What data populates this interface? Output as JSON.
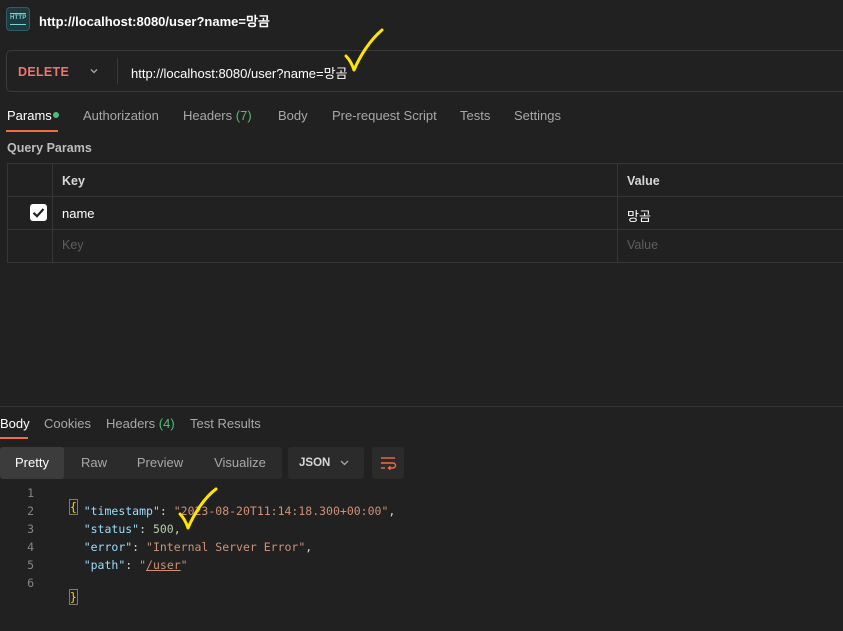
{
  "window": {
    "title": "http://localhost:8080/user?name=망곰",
    "icon": "http-file-icon"
  },
  "request": {
    "method": "DELETE",
    "url": "http://localhost:8080/user?name=망곰",
    "tabs": [
      {
        "label": "Params",
        "active": true,
        "dot": true
      },
      {
        "label": "Authorization"
      },
      {
        "label": "Headers",
        "badge": "(7)"
      },
      {
        "label": "Body"
      },
      {
        "label": "Pre-request Script"
      },
      {
        "label": "Tests"
      },
      {
        "label": "Settings"
      }
    ],
    "query_params": {
      "title": "Query Params",
      "headers": {
        "key": "Key",
        "value": "Value"
      },
      "rows": [
        {
          "checked": true,
          "key": "name",
          "value": "망곰"
        }
      ],
      "placeholder": {
        "key": "Key",
        "value": "Value"
      }
    }
  },
  "response": {
    "tabs": [
      {
        "label": "Body",
        "active": true
      },
      {
        "label": "Cookies"
      },
      {
        "label": "Headers",
        "badge": "(4)"
      },
      {
        "label": "Test Results"
      }
    ],
    "views": [
      "Pretty",
      "Raw",
      "Preview",
      "Visualize"
    ],
    "active_view": "Pretty",
    "format": "JSON",
    "code": {
      "line_numbers": [
        "1",
        "2",
        "3",
        "4",
        "5",
        "6"
      ],
      "open": "{",
      "close": "}",
      "timestamp_key": "\"timestamp\"",
      "timestamp_val": "\"2023-08-20T11:14:18.300+00:00\"",
      "status_key": "\"status\"",
      "status_val": "500",
      "error_key": "\"error\"",
      "error_val": "\"Internal Server Error\"",
      "path_key": "\"path\"",
      "path_val_q1": "\"",
      "path_val": "/user",
      "path_val_q2": "\""
    }
  },
  "colors": {
    "accent": "#ef6c47",
    "method": "#f0756f",
    "badge": "#4fc073",
    "annotation": "#ffe600"
  }
}
